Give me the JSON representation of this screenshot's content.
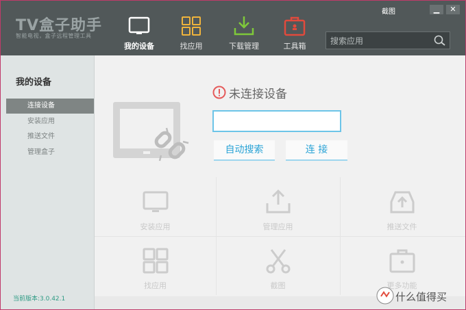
{
  "header": {
    "logo_title": "TV盒子助手",
    "logo_subtitle": "智能电视，盒子远程管理工具",
    "capture_link": "截图",
    "minimize": "▁",
    "close": "✕",
    "search_placeholder": "搜索应用"
  },
  "nav": [
    {
      "label": "我的设备",
      "icon": "tv-icon",
      "active": true
    },
    {
      "label": "找应用",
      "icon": "apps-grid-icon"
    },
    {
      "label": "下载管理",
      "icon": "download-icon"
    },
    {
      "label": "工具箱",
      "icon": "toolbox-icon"
    }
  ],
  "sidebar": {
    "title": "我的设备",
    "items": [
      {
        "label": "连接设备"
      },
      {
        "label": "安装应用"
      },
      {
        "label": "推送文件"
      },
      {
        "label": "管理盒子"
      }
    ],
    "version": "当前版本:3.0.42.1"
  },
  "connection": {
    "status": "未连接设备",
    "ip_value": "",
    "auto_search": "自动搜索",
    "connect": "连  接"
  },
  "features": [
    {
      "label": "安装应用",
      "icon": "monitor-icon"
    },
    {
      "label": "管理应用",
      "icon": "upload-tray-icon"
    },
    {
      "label": "推送文件",
      "icon": "inbox-upload-icon"
    },
    {
      "label": "找应用",
      "icon": "apps-grid-icon"
    },
    {
      "label": "截图",
      "icon": "scissors-icon"
    },
    {
      "label": "更多功能",
      "icon": "briefcase-icon"
    }
  ],
  "watermark": "什么值得买",
  "colors": {
    "titlebar": "#515859",
    "accent": "#2aa3d6",
    "sidebar_active": "#7f8584",
    "alert": "#e55a5a"
  }
}
